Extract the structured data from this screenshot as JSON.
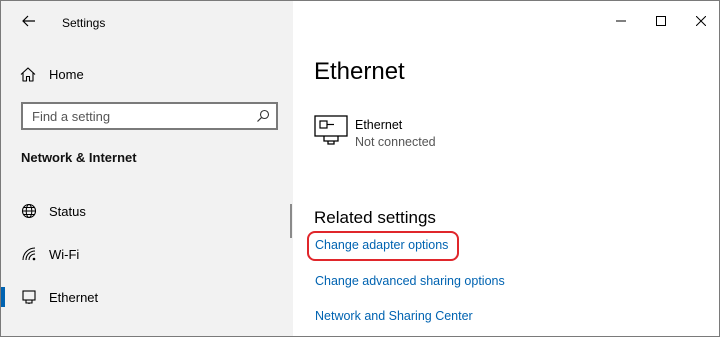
{
  "window": {
    "title": "Settings"
  },
  "sidebar": {
    "home_label": "Home",
    "search_placeholder": "Find a setting",
    "section_heading": "Network & Internet",
    "items": [
      {
        "label": "Status",
        "icon": "globe-icon"
      },
      {
        "label": "Wi-Fi",
        "icon": "wifi-icon"
      },
      {
        "label": "Ethernet",
        "icon": "ethernet-icon",
        "active": true
      }
    ]
  },
  "content": {
    "page_title": "Ethernet",
    "device": {
      "name": "Ethernet",
      "status": "Not connected",
      "icon": "network-adapter-icon"
    },
    "related_heading": "Related settings",
    "links": [
      {
        "label": "Change adapter options",
        "highlighted": true
      },
      {
        "label": "Change advanced sharing options"
      },
      {
        "label": "Network and Sharing Center"
      }
    ]
  },
  "colors": {
    "accent": "#0063b1",
    "sidebar_bg": "#f2f2f2",
    "highlight": "#e0262b"
  }
}
